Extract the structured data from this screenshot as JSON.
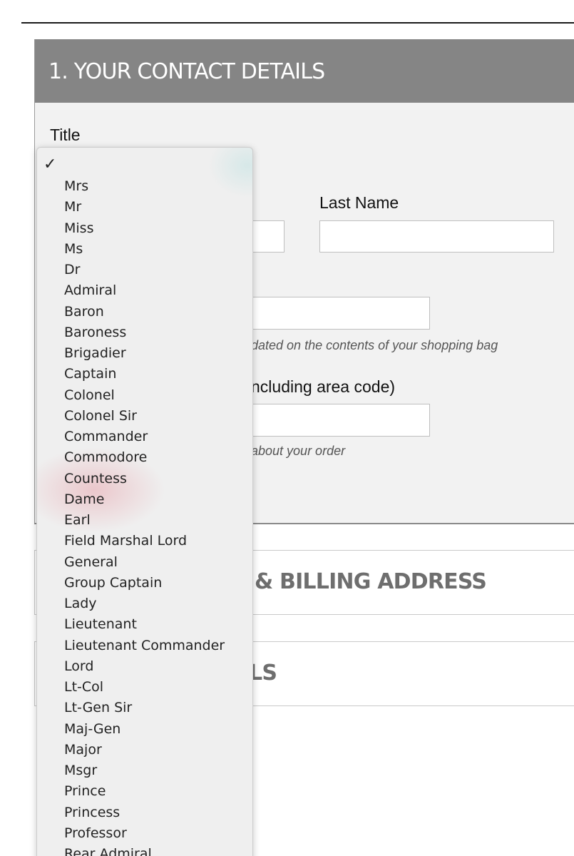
{
  "section1": {
    "title": "1. YOUR CONTACT DETAILS",
    "title_label": "Title",
    "last_name_label": "Last Name",
    "email_hint": "dated on the contents of your shopping bag",
    "phone_label": "ncluding area code)",
    "phone_hint": "about your order"
  },
  "section2": {
    "title": "& BILLING ADDRESS"
  },
  "section3": {
    "title": "LS"
  },
  "dropdown": {
    "selected_mark": "✓",
    "options": [
      "Mrs",
      "Mr",
      "Miss",
      "Ms",
      "Dr",
      "Admiral",
      "Baron",
      "Baroness",
      "Brigadier",
      "Captain",
      "Colonel",
      "Colonel Sir",
      "Commander",
      "Commodore",
      "Countess",
      "Dame",
      "Earl",
      "Field Marshal Lord",
      "General",
      "Group Captain",
      "Lady",
      "Lieutenant",
      "Lieutenant Commander",
      "Lord",
      "Lt-Col",
      "Lt-Gen Sir",
      "Maj-Gen",
      "Major",
      "Msgr",
      "Prince",
      "Princess",
      "Professor",
      "Rear Admiral"
    ]
  }
}
